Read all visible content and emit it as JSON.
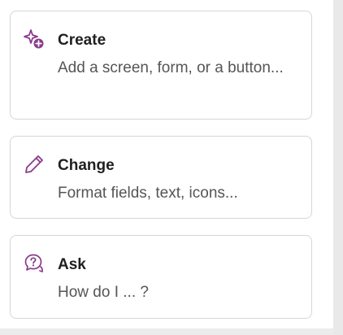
{
  "accent_color": "#8a3a8c",
  "cards": [
    {
      "icon": "sparkle-plus-icon",
      "title": "Create",
      "description": "Add a screen, form, or a button..."
    },
    {
      "icon": "pencil-icon",
      "title": "Change",
      "description": "Format fields, text, icons..."
    },
    {
      "icon": "chat-question-icon",
      "title": "Ask",
      "description": "How do I ... ?"
    }
  ]
}
